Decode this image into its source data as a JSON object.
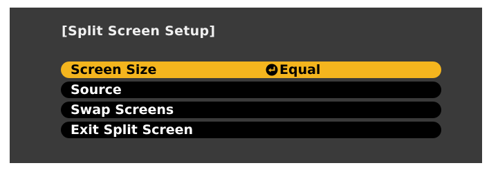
{
  "window": {
    "title": "[Split Screen Setup]"
  },
  "menu": {
    "items": [
      {
        "label": "Screen Size",
        "value": "Equal",
        "selected": true,
        "icon": "enter-icon"
      },
      {
        "label": "Source",
        "value": "",
        "selected": false
      },
      {
        "label": "Swap Screens",
        "value": "",
        "selected": false
      },
      {
        "label": "Exit Split Screen",
        "value": "",
        "selected": false
      }
    ]
  },
  "colors": {
    "background": "#3a3a3a",
    "highlight": "#f4b51e",
    "item_bg": "#000000",
    "text": "#ffffff"
  }
}
